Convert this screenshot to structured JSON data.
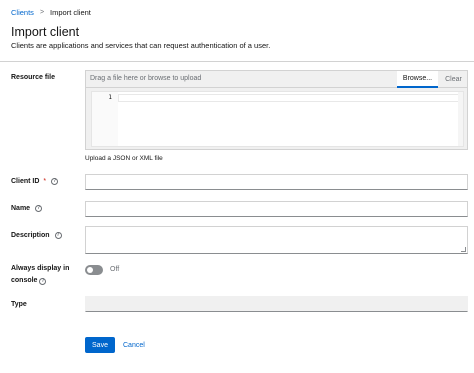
{
  "breadcrumb": {
    "parent": "Clients",
    "separator": ">",
    "current": "Import client"
  },
  "header": {
    "title": "Import client",
    "description": "Clients are applications and services that can request authentication of a user."
  },
  "resource_file": {
    "label": "Resource file",
    "placeholder": "Drag a file here or browse to upload",
    "browse_label": "Browse...",
    "clear_label": "Clear",
    "line_number": "1",
    "helper_text": "Upload a JSON or XML file"
  },
  "client_id": {
    "label": "Client ID",
    "required_marker": "*",
    "value": ""
  },
  "name": {
    "label": "Name",
    "value": ""
  },
  "description": {
    "label": "Description",
    "value": ""
  },
  "always_display": {
    "label_line1": "Always display in",
    "label_line2": "console",
    "state_label": "Off",
    "checked": false
  },
  "type": {
    "label": "Type",
    "value": ""
  },
  "actions": {
    "save_label": "Save",
    "cancel_label": "Cancel"
  },
  "colors": {
    "primary": "#0066cc",
    "required": "#c9190b",
    "muted": "#6a6e73",
    "readonly_bg": "#f0f0f0"
  },
  "icons": {
    "help": "help-icon",
    "breadcrumb_separator": "chevron-right-icon"
  }
}
